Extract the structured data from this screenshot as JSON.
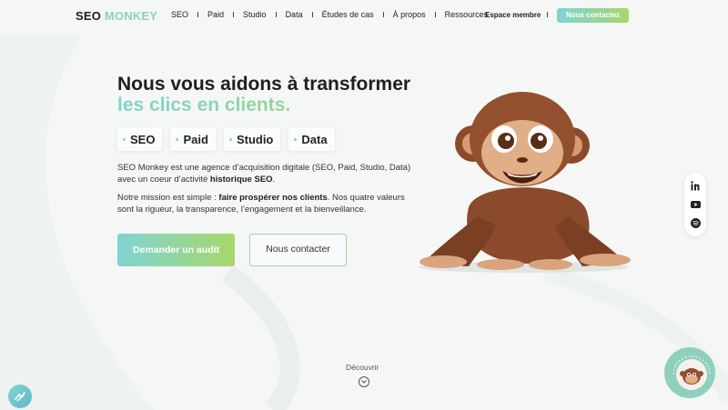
{
  "header": {
    "logo_part1": "SEO",
    "logo_part2": "MONKEY",
    "nav": [
      "SEO",
      "Paid",
      "Studio",
      "Data",
      "Études de cas",
      "À propos",
      "Ressources"
    ],
    "member_label": "Espace membre",
    "contact_label": "Nous contactez"
  },
  "hero": {
    "title_line1": "Nous vous aidons à transformer",
    "title_line2": "les clics en clients.",
    "tags": [
      "SEO",
      "Paid",
      "Studio",
      "Data"
    ],
    "p1_before": "SEO Monkey est une agence d’acquisition digitale (SEO, Paid, Studio, Data) avec un coeur d’activité ",
    "p1_bold": "historique SEO",
    "p1_after": ".",
    "p2_before": "Notre mission est simple : ",
    "p2_bold": "faire prospérer nos clients",
    "p2_after": ". Nos quatre valeurs sont la rigueur, la transparence, l’engagement et la bienveillance.",
    "audit_button": "Demander un audit",
    "contact_button": "Nous contacter"
  },
  "discover_label": "Découvrir",
  "social": [
    "linkedin-icon",
    "youtube-icon",
    "spotify-icon"
  ],
  "colors": {
    "accent_start": "#7fd3d3",
    "accent_end": "#a8d66b",
    "logo_accent": "#8ed3b2"
  }
}
